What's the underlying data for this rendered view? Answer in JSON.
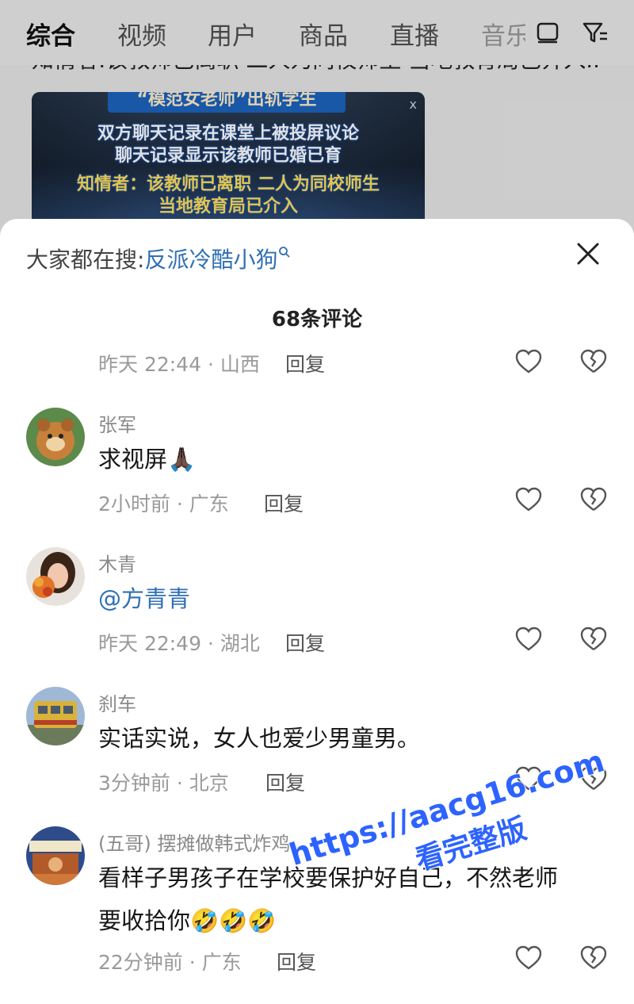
{
  "top_tabs": [
    {
      "label": "综合",
      "active": true
    },
    {
      "label": "视频",
      "active": false
    },
    {
      "label": "用户",
      "active": false
    },
    {
      "label": "商品",
      "active": false
    },
    {
      "label": "直播",
      "active": false
    },
    {
      "label": "音乐",
      "active": false
    }
  ],
  "background": {
    "headline_fragment": "知情者:该教师已离职 二人为同校师生 当地教育局已介入...",
    "video": {
      "title_top": "“模范女老师”出轨学生",
      "line1": "双方聊天记录在课堂上被投屏议论",
      "line2": "聊天记录显示该教师已婚已育",
      "line3": "知情者：该教师已离职 二人为同校师生",
      "line4": "当地教育局已介入",
      "close": "x"
    }
  },
  "sheet": {
    "search_label": "大家都在搜:",
    "search_term": "反派冷酷小狗",
    "comment_count": "68条评论",
    "reply_label": "回复"
  },
  "comments": [
    {
      "name": "",
      "text": "",
      "meta": "昨天 22:44 · 山西"
    },
    {
      "name": "张军",
      "text": "求视屏🙏🏿",
      "meta": "2小时前 · 广东"
    },
    {
      "name": "木青",
      "text": "@方青青",
      "meta": "昨天 22:49 · 湖北"
    },
    {
      "name": "刹车",
      "text": "实话实说，女人也爱少男童男。",
      "meta": "3分钟前 · 北京"
    },
    {
      "name": "(五哥) 摆摊做韩式炸鸡",
      "text": "看样子男孩子在学校要保护好自己，不然老师",
      "text2": "要收拾你🤣🤣🤣",
      "meta": "22分钟前 · 广东"
    }
  ],
  "watermark": {
    "url": "https://aacg16.com",
    "sub": "看完整版"
  },
  "colors": {
    "accent_blue": "#2f6fb4",
    "watermark_blue": "#2d63ff"
  }
}
